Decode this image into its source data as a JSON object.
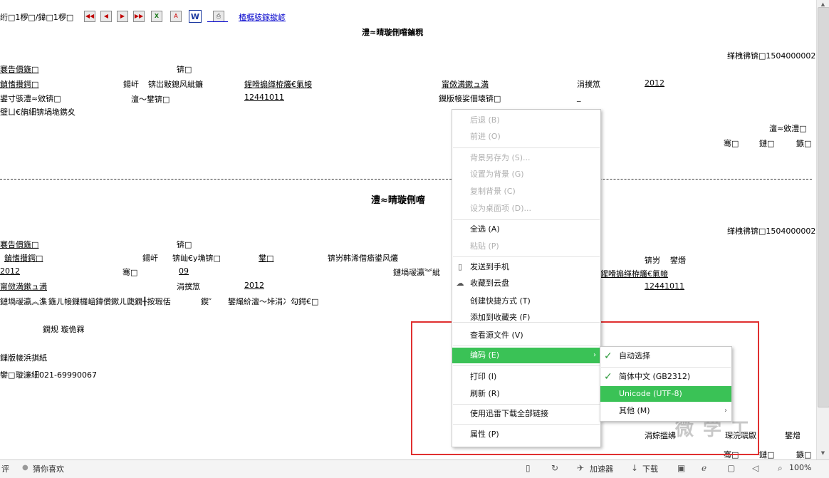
{
  "toolbar": {
    "page_indicator": "绗□1椤□/鍏□1椤□",
    "buttons": [
      "first-page-icon",
      "prev-page-icon",
      "next-page-icon",
      "last-page-icon",
      "excel-icon",
      "pdf-icon",
      "word-icon",
      "print-icon"
    ],
    "link": "楂樼骇鎵撳嵃"
  },
  "report": {
    "title1": "澧≈晴璇侀噾鏀粯",
    "serial1": "缂栧彿锛□1504000002",
    "row1_label": "褰告價鍦□",
    "row1_c2": "锛□",
    "row2_c1": "鍞愭攢鍔□",
    "row2_c2": "鍚屽",
    "row2_c3": "锛岀敤鎴风紪鐮",
    "row2_c4": "鍟嗗搧缂栫爜€氭帹",
    "row2_c5": "甯傚満鏉ュ満",
    "row2_c6": "涓撲笟",
    "row2_c7": "2012",
    "row3_c1": "鍙寸骇澧≈敓锛□",
    "row3_c2": "澶〜鐢锛□",
    "row3_c3": "12441011",
    "row3_c4": "鏁版帹娑佃壊锛□",
    "row3_c5": "_",
    "row4_c1": "璧ㄩ€旓細锛堝垝鎸夊",
    "right_label": "澶≈敓澧□",
    "sig1": "骞□",
    "sig2": "鏈□",
    "sig3": "鏃□",
    "title2": "澧≈晴璇侀噾",
    "serial2": "缂栧彿锛□1504000002",
    "r5_c1": "褰告價鍦□",
    "r5_c2": "锛□",
    "r6_c1": "鍞愭攢鍔□",
    "r6_c2": "鍚屽",
    "r6_c3": "锛屾€у埆锛□",
    "r6_c4": "鐢□",
    "r6_c5": "锛岃韩浠借瘉鍙风爜",
    "r6_c6": "锛岃",
    "r6_c7": "鐢熸",
    "r7_c1": "2012",
    "r7_c2": "骞□",
    "r7_c3": "09",
    "r7_c4": "鏈堝叆瀛︾紪",
    "r7_c5": "鍟嗗搧缂栫爜€氭帹",
    "r8_c1": "甯傚満鏉ュ満",
    "r8_c2": "涓撲笟",
    "r8_c3": "2012",
    "r8_c4": "12441011",
    "r9_c1": "鏈堝叆瀛︽潗",
    "r9_c2": "鍦ㄦ帹鏁欏崡鍏儹鏉ㄦ瓟鐗╂按瑕佸",
    "r9_c3": "鍥″",
    "r9_c4": "鐢熶紒澶〜垰涓冫勾鍔€□",
    "r10": "鐗规  璇佹槑",
    "r11": "鏁版帹浜掑紙",
    "r12_label": "鐢□",
    "r12_val": "璇濓細021-69990067",
    "bottom_right": "涓婃搵绋",
    "bottom_right2": "琛浣曞叞",
    "bottom_right3": "鐢熷",
    "bottom_sig1": "骞□",
    "bottom_sig2": "鏈□",
    "bottom_sig3": "鏃□"
  },
  "context_menu": {
    "items": [
      {
        "label": "后退 (B)",
        "disabled": true
      },
      {
        "label": "前进 (O)",
        "disabled": true
      },
      {
        "label": "背景另存为 (S)...",
        "disabled": true
      },
      {
        "label": "设置为背景 (G)",
        "disabled": true
      },
      {
        "label": "复制背景 (C)",
        "disabled": true
      },
      {
        "label": "设为桌面项 (D)...",
        "disabled": true
      },
      {
        "label": "全选 (A)",
        "disabled": false
      },
      {
        "label": "粘贴 (P)",
        "disabled": true
      },
      {
        "label": "发送到手机",
        "disabled": false
      },
      {
        "label": "收藏到云盘",
        "disabled": false
      },
      {
        "label": "创建快捷方式 (T)",
        "disabled": false
      },
      {
        "label": "添加到收藏夹 (F)",
        "disabled": false
      },
      {
        "label": "查看源文件 (V)",
        "disabled": false
      },
      {
        "label": "编码 (E)",
        "disabled": false
      },
      {
        "label": "打印 (I)",
        "disabled": false
      },
      {
        "label": "刷新 (R)",
        "disabled": false
      },
      {
        "label": "使用迅雷下载全部链接",
        "disabled": false
      },
      {
        "label": "属性 (P)",
        "disabled": false
      }
    ]
  },
  "encoding_submenu": {
    "items": [
      {
        "label": "自动选择",
        "checked": true
      },
      {
        "label": "简体中文 (GB2312)",
        "checked": true
      },
      {
        "label": "Unicode (UTF-8)",
        "checked": false
      },
      {
        "label": "其他 (M)",
        "checked": false
      }
    ]
  },
  "status_bar": {
    "left_text": "评",
    "guess": "猜你喜欢",
    "accelerator": "加速器",
    "download": "下载",
    "zoom": "100%"
  },
  "watermark": "微 学 工",
  "colors": {
    "highlight": "#3ac256",
    "annotation_box": "#e03030",
    "link": "#0000cc"
  }
}
